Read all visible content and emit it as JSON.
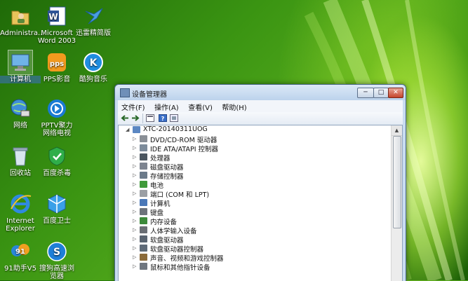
{
  "desktop": {
    "icons": [
      {
        "label": "Administra...",
        "icon": "user-folder-icon"
      },
      {
        "label": "Microsoft Word 2003",
        "icon": "word-icon"
      },
      {
        "label": "迅雷精简版",
        "icon": "thunder-icon"
      },
      {
        "label": "计算机",
        "icon": "computer-icon"
      },
      {
        "label": "PPS影音",
        "icon": "pps-icon"
      },
      {
        "label": "酷狗音乐",
        "icon": "kugou-icon"
      },
      {
        "label": "网络",
        "icon": "network-icon"
      },
      {
        "label": "PPTV聚力 网络电视",
        "icon": "pptv-icon"
      },
      {
        "label": "回收站",
        "icon": "recycle-bin-icon"
      },
      {
        "label": "百度杀毒",
        "icon": "baidu-antivirus-icon"
      },
      {
        "label": "Internet Explorer",
        "icon": "ie-icon"
      },
      {
        "label": "百度卫士",
        "icon": "baidu-guard-icon"
      },
      {
        "label": "91助手V5",
        "icon": "assistant-91-icon"
      },
      {
        "label": "搜狗高速浏览器",
        "icon": "sogou-browser-icon"
      }
    ]
  },
  "window": {
    "title": "设备管理器",
    "controls": {
      "minimize": "─",
      "maximize": "□",
      "close": "✕"
    },
    "menu": [
      "文件(F)",
      "操作(A)",
      "查看(V)",
      "帮助(H)"
    ],
    "root": "XTC-20140311UOG",
    "devices": [
      {
        "label": "DVD/CD-ROM 驱动器",
        "icon": "dvd-drive-icon",
        "color": "#8a8f96"
      },
      {
        "label": "IDE ATA/ATAPI 控制器",
        "icon": "ide-controller-icon",
        "color": "#7c8b9a"
      },
      {
        "label": "处理器",
        "icon": "processor-icon",
        "color": "#4b5660"
      },
      {
        "label": "磁盘驱动器",
        "icon": "disk-drive-icon",
        "color": "#7d8490"
      },
      {
        "label": "存储控制器",
        "icon": "storage-controller-icon",
        "color": "#6b7a8a"
      },
      {
        "label": "电池",
        "icon": "battery-icon",
        "color": "#3f9a3a"
      },
      {
        "label": "端口 (COM 和 LPT)",
        "icon": "port-icon",
        "color": "#9b9fa4"
      },
      {
        "label": "计算机",
        "icon": "computer-icon",
        "color": "#4a78b8"
      },
      {
        "label": "键盘",
        "icon": "keyboard-icon",
        "color": "#6d737b"
      },
      {
        "label": "内存设备",
        "icon": "memory-icon",
        "color": "#3c8a3a"
      },
      {
        "label": "人体学输入设备",
        "icon": "hid-icon",
        "color": "#6a6e74"
      },
      {
        "label": "软盘驱动器",
        "icon": "floppy-drive-icon",
        "color": "#5a6470"
      },
      {
        "label": "软盘驱动器控制器",
        "icon": "floppy-controller-icon",
        "color": "#5f6b78"
      },
      {
        "label": "声音、视频和游戏控制器",
        "icon": "sound-icon",
        "color": "#8b6b3a"
      },
      {
        "label": "鼠标和其他指针设备",
        "icon": "mouse-icon",
        "color": "#707780"
      }
    ]
  }
}
